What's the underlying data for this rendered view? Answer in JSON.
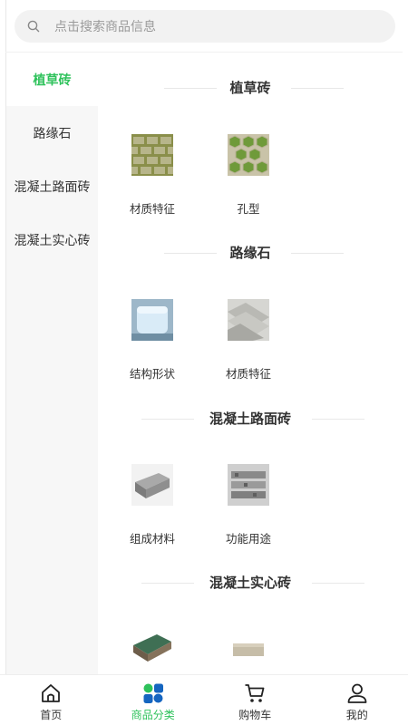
{
  "search": {
    "placeholder": "点击搜索商品信息"
  },
  "sidebar": {
    "items": [
      {
        "label": "植草砖",
        "active": true
      },
      {
        "label": "路缘石",
        "active": false
      },
      {
        "label": "混凝土路面砖",
        "active": false
      },
      {
        "label": "混凝土实心砖",
        "active": false
      }
    ]
  },
  "sections": [
    {
      "title": "植草砖",
      "items": [
        {
          "label": "材质特征",
          "icon": "grass-brick-photo"
        },
        {
          "label": "孔型",
          "icon": "hexagon-brick-photo"
        }
      ]
    },
    {
      "title": "路缘石",
      "items": [
        {
          "label": "结构形状",
          "icon": "curb-stone-photo"
        },
        {
          "label": "材质特征",
          "icon": "curb-stack-photo"
        }
      ]
    },
    {
      "title": "混凝土路面砖",
      "items": [
        {
          "label": "组成材料",
          "icon": "paver-block-photo"
        },
        {
          "label": "功能用途",
          "icon": "paver-stack-photo"
        }
      ]
    },
    {
      "title": "混凝土实心砖",
      "items": [
        {
          "label": "",
          "icon": "green-paver-photo"
        },
        {
          "label": "",
          "icon": "solid-brick-photo"
        }
      ]
    }
  ],
  "tabbar": {
    "tabs": [
      {
        "label": "首页",
        "icon": "home-icon",
        "active": false
      },
      {
        "label": "商品分类",
        "icon": "category-icon",
        "active": true
      },
      {
        "label": "购物车",
        "icon": "cart-icon",
        "active": false
      },
      {
        "label": "我的",
        "icon": "user-icon",
        "active": false
      }
    ]
  },
  "colors": {
    "accent": "#2ec25b",
    "sidebar_bg": "#f7f7f7",
    "search_bg": "#f2f2f2"
  }
}
